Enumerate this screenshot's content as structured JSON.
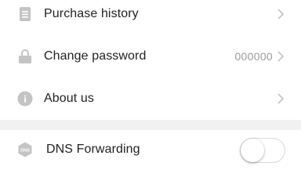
{
  "settings": {
    "purchase_history": {
      "label": "Purchase history",
      "icon": "document-icon"
    },
    "change_password": {
      "label": "Change password",
      "value": "000000",
      "icon": "lock-icon"
    },
    "about_us": {
      "label": "About us",
      "icon": "info-icon",
      "icon_glyph": "i"
    },
    "dns_forwarding": {
      "label": "DNS Forwarding",
      "icon": "dns-icon",
      "icon_text": "DNS",
      "enabled": false
    }
  },
  "colors": {
    "icon_gray": "#c4c4c4",
    "text": "#222222",
    "secondary_text": "#9a9a9a",
    "section_band": "#f1f1f1"
  }
}
